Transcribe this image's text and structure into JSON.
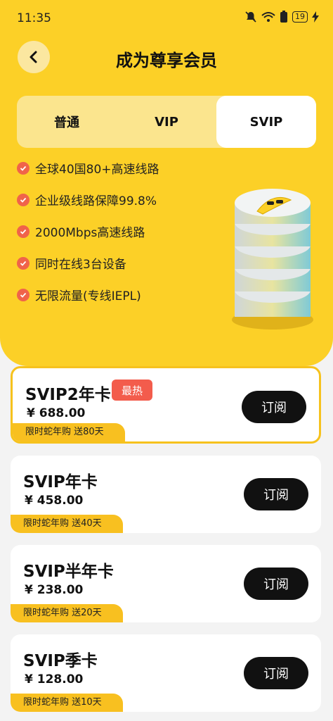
{
  "status_bar": {
    "time": "11:35",
    "battery": "19"
  },
  "header": {
    "title": "成为尊享会员"
  },
  "tabs": [
    {
      "label": "普通",
      "active": false
    },
    {
      "label": "VIP",
      "active": false
    },
    {
      "label": "SVIP",
      "active": true
    }
  ],
  "features": [
    "全球40国80+高速线路",
    "企业级线路保障99.8%",
    "2000Mbps高速线路",
    "同时在线3台设备",
    "无限流量(专线IEPL)"
  ],
  "plans": [
    {
      "name": "SVIP2年卡",
      "badge": "最热",
      "price": "¥ 688.00",
      "promo": "限时蛇年购 送80天",
      "button": "订阅"
    },
    {
      "name": "SVIP年卡",
      "price": "¥ 458.00",
      "promo": "限时蛇年购 送40天",
      "button": "订阅"
    },
    {
      "name": "SVIP半年卡",
      "price": "¥ 238.00",
      "promo": "限时蛇年购 送20天",
      "button": "订阅"
    },
    {
      "name": "SVIP季卡",
      "price": "¥ 128.00",
      "promo": "限时蛇年购 送10天",
      "button": "订阅"
    }
  ],
  "colors": {
    "brand_yellow": "#fcd027",
    "check_red": "#f0634a",
    "hot_red": "#f35c4c",
    "button_black": "#111111"
  },
  "icons": [
    "back-arrow-icon",
    "mute-bell-icon",
    "wifi-icon",
    "battery-saver-icon",
    "charging-icon",
    "check-circle-icon",
    "banana-coin-stack-icon"
  ]
}
